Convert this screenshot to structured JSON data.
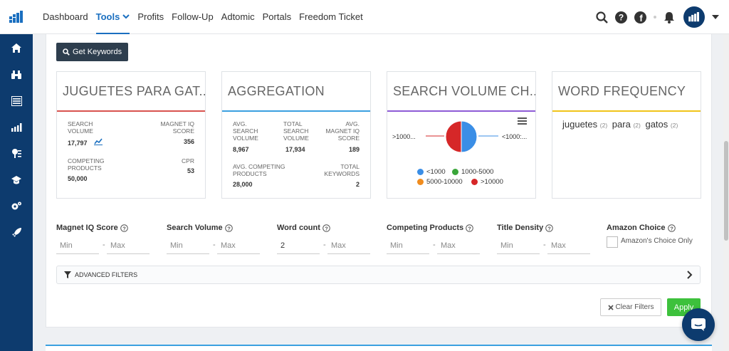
{
  "nav": {
    "items": [
      {
        "label": "Dashboard"
      },
      {
        "label": "Tools"
      },
      {
        "label": "Profits"
      },
      {
        "label": "Follow-Up"
      },
      {
        "label": "Adtomic"
      },
      {
        "label": "Portals"
      },
      {
        "label": "Freedom Ticket"
      }
    ],
    "active": "Tools"
  },
  "toolbar": {
    "get_keywords": "Get Keywords"
  },
  "panels": {
    "keyword": {
      "title": "JUGUETES PARA GAT...",
      "accent": "#d9534f",
      "search_volume_label": "SEARCH VOLUME",
      "search_volume": "17,797",
      "magnet_iq_label": "MAGNET IQ SCORE",
      "magnet_iq": "356",
      "competing_label": "COMPETING PRODUCTS",
      "competing": "50,000",
      "cpr_label": "CPR",
      "cpr": "53"
    },
    "aggregation": {
      "title": "AGGREGATION",
      "accent": "#3aa0e0",
      "avg_sv_label": "AVG. SEARCH VOLUME",
      "avg_sv": "8,967",
      "total_sv_label": "TOTAL SEARCH VOLUME",
      "total_sv": "17,934",
      "avg_iq_label": "AVG. MAGNET IQ SCORE",
      "avg_iq": "189",
      "avg_cp_label": "AVG. COMPETING PRODUCTS",
      "avg_cp": "28,000",
      "total_kw_label": "TOTAL KEYWORDS",
      "total_kw": "2"
    },
    "search_volume_chart": {
      "title": "SEARCH VOLUME CH...",
      "accent": "#8e5bd6",
      "left_label": ">1000...",
      "right_label": "<1000:...",
      "legend": [
        {
          "label": "<1000",
          "color": "#3a8ee6"
        },
        {
          "label": "1000-5000",
          "color": "#3aa63a"
        },
        {
          "label": "5000-10000",
          "color": "#f08c1e"
        },
        {
          "label": ">10000",
          "color": "#d62728"
        }
      ]
    },
    "word_frequency": {
      "title": "WORD FREQUENCY",
      "accent": "#f0c419",
      "words": [
        {
          "word": "juguetes",
          "count": "(2)"
        },
        {
          "word": "para",
          "count": "(2)"
        },
        {
          "word": "gatos",
          "count": "(2)"
        }
      ]
    }
  },
  "chart_data": {
    "type": "pie",
    "categories": [
      "<1000",
      "1000-5000",
      "5000-10000",
      ">10000"
    ],
    "values": [
      1,
      0,
      0,
      1
    ],
    "colors": [
      "#3a8ee6",
      "#3aa63a",
      "#f08c1e",
      "#d62728"
    ],
    "legend": "bottom"
  },
  "filters": {
    "magnet_iq": {
      "label": "Magnet IQ Score",
      "min": "",
      "max": ""
    },
    "search_volume": {
      "label": "Search Volume",
      "min": "",
      "max": ""
    },
    "word_count": {
      "label": "Word count",
      "min": "2",
      "max": ""
    },
    "competing": {
      "label": "Competing Products",
      "min": "",
      "max": ""
    },
    "title_density": {
      "label": "Title Density",
      "min": "",
      "max": ""
    },
    "amazon_choice": {
      "label": "Amazon Choice",
      "checkbox_label": "Amazon's Choice Only"
    },
    "min_placeholder": "Min",
    "max_placeholder": "Max",
    "dash": "-"
  },
  "advanced_filters": "ADVANCED FILTERS",
  "actions": {
    "clear": "Clear Filters",
    "apply": "Apply"
  }
}
